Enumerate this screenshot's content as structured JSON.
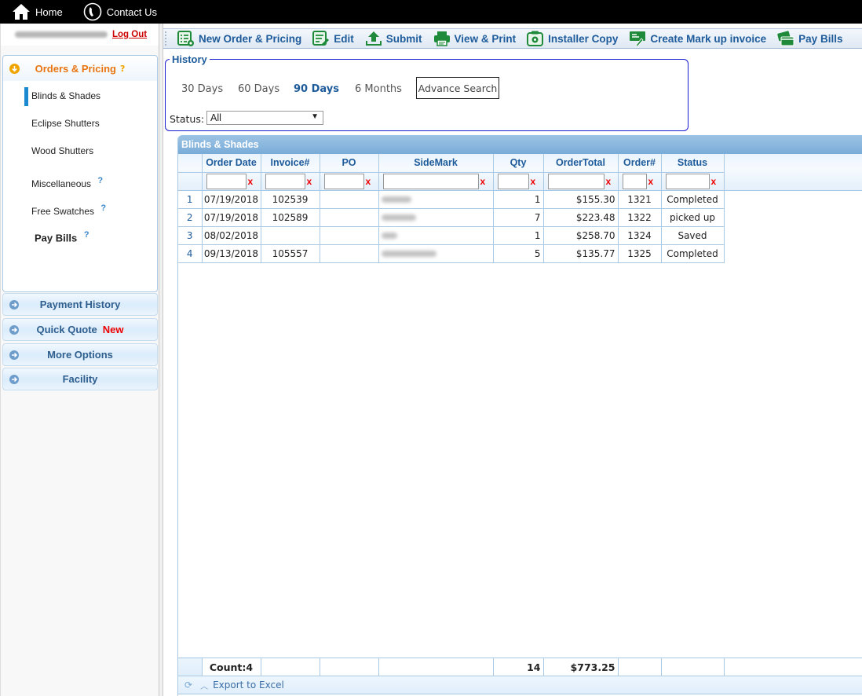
{
  "topnav": {
    "home_label": "Home",
    "contact_label": "Contact Us"
  },
  "user": {
    "email_masked": "(blurred email)",
    "logout_label": "Log Out"
  },
  "sidebar": {
    "orders_panel": {
      "title": "Orders & Pricing",
      "help": "?",
      "items": [
        {
          "label": "Blinds & Shades",
          "active": true
        },
        {
          "label": "Eclipse Shutters"
        },
        {
          "label": "Wood Shutters"
        },
        {
          "label": "Miscellaneous",
          "help": "?"
        },
        {
          "label": "Free Swatches",
          "help": "?"
        },
        {
          "label": "Pay Bills",
          "help": "?"
        }
      ]
    },
    "sections": [
      {
        "label": "Payment History"
      },
      {
        "label": "Quick Quote",
        "badge": "New"
      },
      {
        "label": "More Options"
      },
      {
        "label": "Facility"
      }
    ]
  },
  "toolbar": {
    "buttons": [
      {
        "label": "New Order & Pricing",
        "icon": "new-order-icon"
      },
      {
        "label": "Edit",
        "icon": "edit-icon"
      },
      {
        "label": "Submit",
        "icon": "upload-icon"
      },
      {
        "label": "View & Print",
        "icon": "printer-icon"
      },
      {
        "label": "Installer Copy",
        "icon": "installer-copy-icon"
      },
      {
        "label": "Create Mark up invoice",
        "icon": "markup-invoice-icon"
      },
      {
        "label": "Pay Bills",
        "icon": "credit-card-icon"
      }
    ],
    "icon_color": "#1f8a3a",
    "label_color": "#1e5b9a"
  },
  "history": {
    "legend": "History",
    "ranges": [
      {
        "label": "30 Days"
      },
      {
        "label": "60 Days"
      },
      {
        "label": "90 Days",
        "selected": true
      },
      {
        "label": "6 Months"
      }
    ],
    "advance_search_label": "Advance Search",
    "status_label": "Status:",
    "status_value": "All"
  },
  "grid": {
    "title": "Blinds & Shades",
    "columns": [
      "Order Date",
      "Invoice#",
      "PO",
      "SideMark",
      "Qty",
      "OrderTotal",
      "Order#",
      "Status"
    ],
    "filter_clear": "x",
    "rows": [
      {
        "num": "1",
        "order_date": "07/19/2018",
        "invoice": "102539",
        "po": "",
        "sidemark": "(blurred)",
        "qty": "1",
        "total": "$155.30",
        "order_no": "1321",
        "status": "Completed"
      },
      {
        "num": "2",
        "order_date": "07/19/2018",
        "invoice": "102589",
        "po": "",
        "sidemark": "(blurred)",
        "qty": "7",
        "total": "$223.48",
        "order_no": "1322",
        "status": "picked up"
      },
      {
        "num": "3",
        "order_date": "08/02/2018",
        "invoice": "",
        "po": "",
        "sidemark": "(blurred)",
        "qty": "1",
        "total": "$258.70",
        "order_no": "1324",
        "status": "Saved"
      },
      {
        "num": "4",
        "order_date": "09/13/2018",
        "invoice": "105557",
        "po": "",
        "sidemark": "(blurred)",
        "qty": "5",
        "total": "$135.77",
        "order_no": "1325",
        "status": "Completed"
      }
    ],
    "footer": {
      "count": "Count:4",
      "qty_total": "14",
      "order_total": "$773.25"
    },
    "export_label": "Export to Excel"
  }
}
